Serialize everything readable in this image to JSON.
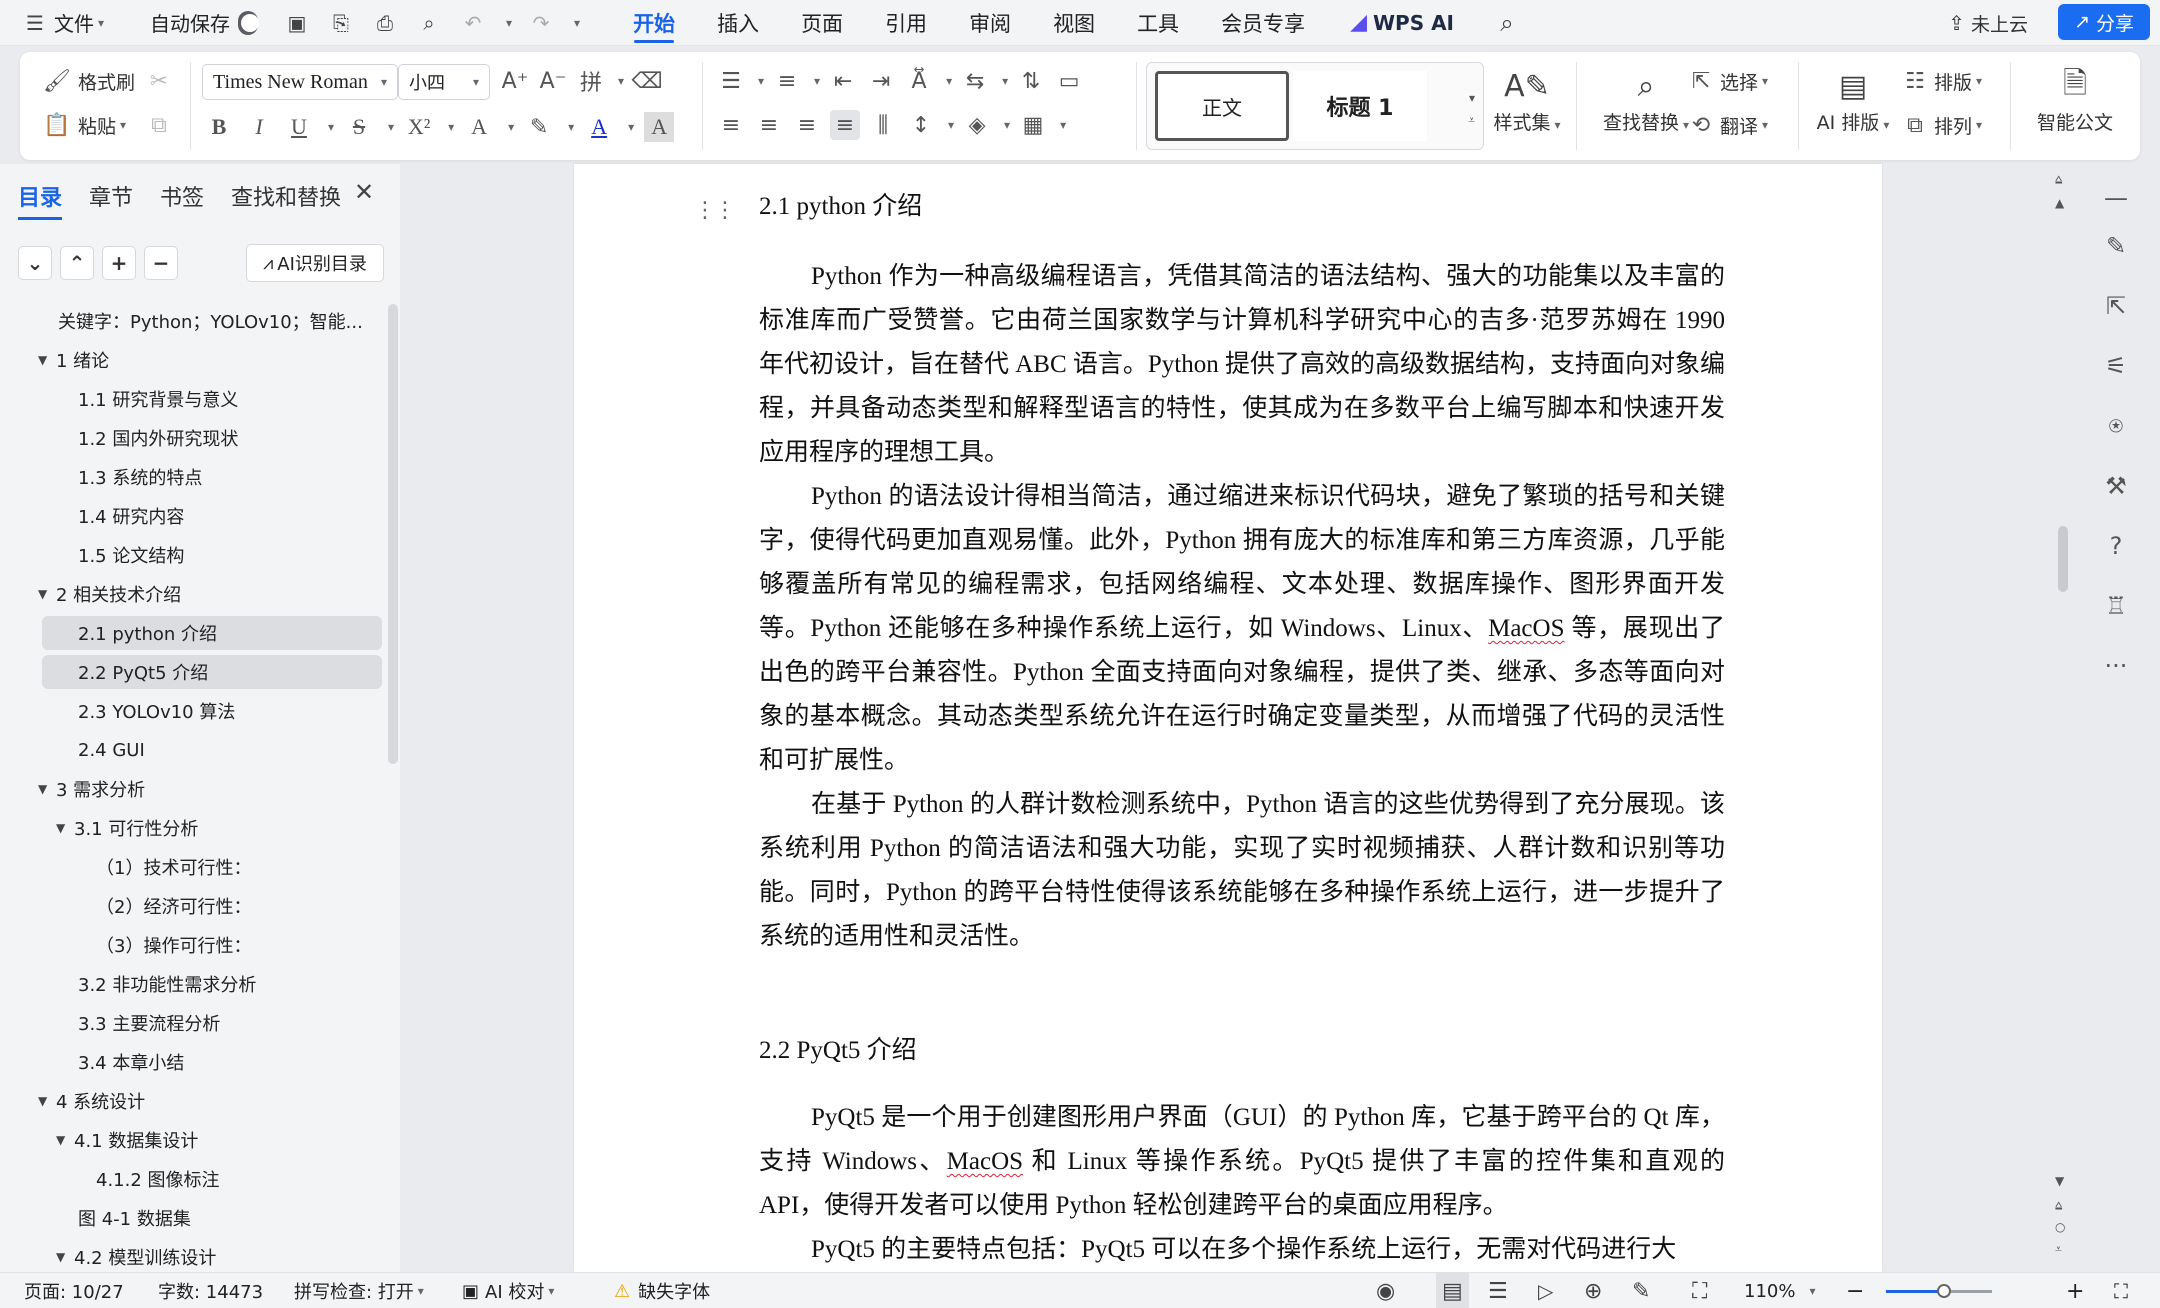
{
  "menubar": {
    "file": "文件",
    "autosave": "自动保存",
    "tabs": [
      "开始",
      "插入",
      "页面",
      "引用",
      "审阅",
      "视图",
      "工具",
      "会员专享"
    ],
    "active_tab": "开始",
    "wps_ai": "WPS AI",
    "cloud": "未上云",
    "share": "分享"
  },
  "ribbon": {
    "format_painter": "格式刷",
    "paste": "粘贴",
    "font_name": "Times New Roman",
    "font_size": "小四",
    "styles": [
      "正文",
      "标题 1"
    ],
    "style_set": "样式集",
    "find_replace": "查找替换",
    "select": "选择",
    "translate": "翻译",
    "ai_layout": "AI 排版",
    "typeset": "排版",
    "arrange": "排列",
    "smart_doc": "智能公文"
  },
  "leftpanel": {
    "tabs": [
      "目录",
      "章节",
      "书签",
      "查找和替换"
    ],
    "ai_dir": "AI识别目录",
    "toc": [
      {
        "label": "关键字：Python；YOLOv10；智能...",
        "level": 0,
        "arrow": ""
      },
      {
        "label": "1  绪论",
        "level": 0,
        "arrow": "▼"
      },
      {
        "label": "1.1 研究背景与意义",
        "level": 1,
        "arrow": ""
      },
      {
        "label": "1.2 国内外研究现状",
        "level": 1,
        "arrow": ""
      },
      {
        "label": "1.3 系统的特点",
        "level": 1,
        "arrow": ""
      },
      {
        "label": "1.4 研究内容",
        "level": 1,
        "arrow": ""
      },
      {
        "label": "1.5 论文结构",
        "level": 1,
        "arrow": ""
      },
      {
        "label": "2  相关技术介绍",
        "level": 0,
        "arrow": "▼"
      },
      {
        "label": "2.1 python 介绍",
        "level": 1,
        "arrow": ""
      },
      {
        "label": "2.2 PyQt5 介绍",
        "level": 1,
        "arrow": ""
      },
      {
        "label": "2.3 YOLOv10 算法",
        "level": 1,
        "arrow": ""
      },
      {
        "label": "2.4 GUI",
        "level": 1,
        "arrow": ""
      },
      {
        "label": "3  需求分析",
        "level": 0,
        "arrow": "▼"
      },
      {
        "label": "3.1 可行性分析",
        "level": 1,
        "arrow": "▼"
      },
      {
        "label": "（1）技术可行性：",
        "level": 2,
        "arrow": ""
      },
      {
        "label": "（2）经济可行性：",
        "level": 2,
        "arrow": ""
      },
      {
        "label": "（3）操作可行性：",
        "level": 2,
        "arrow": ""
      },
      {
        "label": "3.2  非功能性需求分析",
        "level": 1,
        "arrow": ""
      },
      {
        "label": "3.3 主要流程分析",
        "level": 1,
        "arrow": ""
      },
      {
        "label": "3.4 本章小结",
        "level": 1,
        "arrow": ""
      },
      {
        "label": "4  系统设计",
        "level": 0,
        "arrow": "▼"
      },
      {
        "label": "4.1  数据集设计",
        "level": 1,
        "arrow": "▼"
      },
      {
        "label": "4.1.2 图像标注",
        "level": 2,
        "arrow": ""
      },
      {
        "label": "图 4-1  数据集",
        "level": 1,
        "arrow": ""
      },
      {
        "label": "4.2  模型训练设计",
        "level": 1,
        "arrow": "▼"
      }
    ]
  },
  "doc": {
    "h1": "2.1 python 介绍",
    "p1": "Python 作为一种高级编程语言，凭借其简洁的语法结构、强大的功能集以及丰富的标准库而广受赞誉。它由荷兰国家数学与计算机科学研究中心的吉多·范罗苏姆在 1990 年代初设计，旨在替代 ABC 语言。Python 提供了高效的高级数据结构，支持面向对象编程，并具备动态类型和解释型语言的特性，使其成为在多数平台上编写脚本和快速开发应用程序的理想工具。",
    "p2a": "Python 的语法设计得相当简洁，通过缩进来标识代码块，避免了繁琐的括号和关键字，使得代码更加直观易懂。此外，Python 拥有庞大的标准库和第三方库资源，几乎能够覆盖所有常见的编程需求，包括网络编程、文本处理、数据库操作、图形界面开发等。Python 还能够在多种操作系统上运行，如 Windows、Linux、",
    "p2_macos": "MacOS",
    "p2b": " 等，展现出了出色的跨平台兼容性。Python 全面支持面向对象编程，提供了类、继承、多态等面向对象的基本概念。其动态类型系统允许在运行时确定变量类型，从而增强了代码的灵活性和可扩展性。",
    "p3": "在基于 Python 的人群计数检测系统中，Python 语言的这些优势得到了充分展现。该系统利用 Python 的简洁语法和强大功能，实现了实时视频捕获、人群计数和识别等功能。同时，Python 的跨平台特性使得该系统能够在多种操作系统上运行，进一步提升了系统的适用性和灵活性。",
    "h2": "2.2 PyQt5 介绍",
    "p4a": "PyQt5 是一个用于创建图形用户界面（GUI）的 Python 库，它基于跨平台的 Qt 库，支持 Windows、",
    "p4_macos": "MacOS",
    "p4b": " 和 Linux 等操作系统。PyQt5 提供了丰富的控件集和直观的 API，使得开发者可以使用 Python 轻松创建跨平台的桌面应用程序。",
    "p5": "PyQt5 的主要特点包括：PyQt5 可以在多个操作系统上运行，无需对代码进行大"
  },
  "status": {
    "page": "页面: 10/27",
    "words": "字数: 14473",
    "spell": "拼写检查: 打开",
    "ai_proof": "AI 校对",
    "missing_font": "缺失字体",
    "zoom": "110%",
    "zoom_fraction": 0.55
  },
  "colors": {
    "accent": "#1a63e8",
    "share": "#1a6cf0",
    "spell_error": "#dd2233"
  }
}
